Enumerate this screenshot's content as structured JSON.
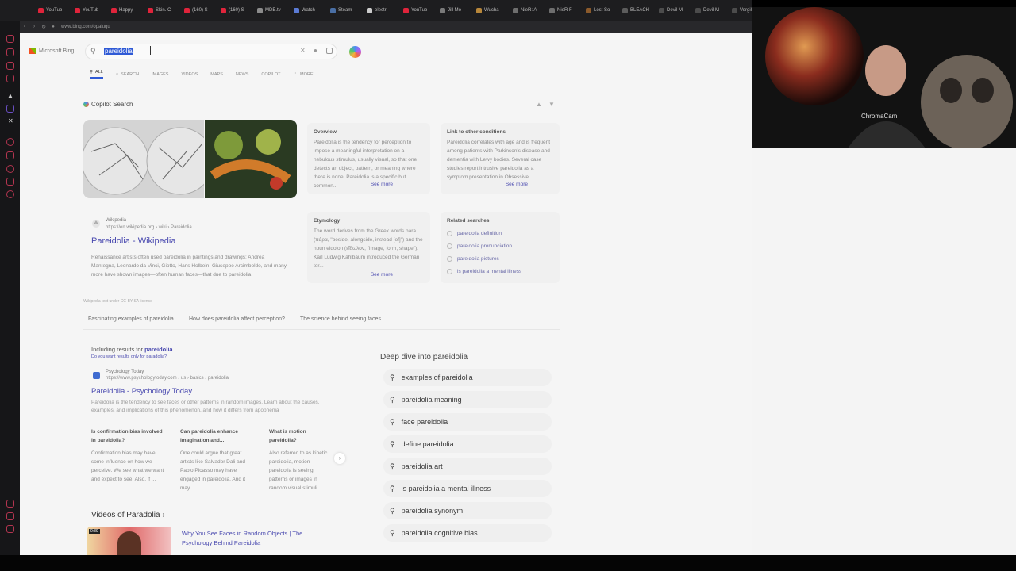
{
  "browser": {
    "tabs": [
      "YouTub",
      "YouTub",
      "Happy",
      "Skin. C",
      "(160) S",
      "(160) S",
      "MDE.tv",
      "Watch",
      "Steam",
      "electr",
      "YouTub",
      "Jill Mo",
      "Wucha",
      "NieR: A",
      "NieR F",
      "Lost So",
      "BLEACH",
      "Devil M",
      "Devil M",
      "Vergil"
    ],
    "tab_colors": [
      "#e0243b",
      "#e0243b",
      "#e0243b",
      "#e0243b",
      "#e0243b",
      "#e0243b",
      "#8c8c8c",
      "#5b7bd5",
      "#4a6fa5",
      "#cccccc",
      "#e0243b",
      "#7a7a7a",
      "#b8873a",
      "#6e6e6e",
      "#6e6e6e",
      "#8b5a2b",
      "#5c5c5c",
      "#4c4c4c",
      "#4c4c4c",
      "#4c4c4c"
    ],
    "url": "www.bing.com/opaluqu"
  },
  "search": {
    "brand": "Microsoft Bing",
    "query": "pareidolia",
    "scopes": [
      "ALL",
      "SEARCH",
      "IMAGES",
      "VIDEOS",
      "MAPS",
      "NEWS",
      "COPILOT",
      "MORE"
    ]
  },
  "copilot": {
    "title": "Copilot Search",
    "wiki_source": "Wikipedia",
    "wiki_url": "https://en.wikipedia.org › wiki › Pareidolia",
    "wiki_title": "Pareidolia - Wikipedia",
    "wiki_snippet": "Renaissance artists often used pareidolia in paintings and drawings: Andrea Mantegna, Leonardo da Vinci, Giotto, Hans Holbein, Giuseppe Arcimboldo, and many more have shown images—often human faces—that due to pareidolia",
    "wiki_license": "Wikipedia text under CC-BY-SA license",
    "overview_title": "Overview",
    "overview_text": "Pareidolia is the tendency for perception to impose a meaningful interpretation on a nebulous stimulus, usually visual, so that one detects an object, pattern, or meaning where there is none. Pareidolia is a specific but common...",
    "see_more": "See more",
    "link_title": "Link to other conditions",
    "link_text": "Pareidolia correlates with age and is frequent among patients with Parkinson's disease and dementia with Lewy bodies. Several case studies report intrusive pareidolia as a symptom presentation in Obsessive ...",
    "etym_title": "Etymology",
    "etym_text": "The word derives from the Greek words para (πάρα, \"beside, alongside, instead [of]\") and the noun eidolon (εἴδωλον, \"image, form, shape\"). Karl Ludwig Kahlbaum introduced the German ter...",
    "related_title": "Related searches",
    "related": [
      "pareidolia definition",
      "pareidolia pronunciation",
      "pareidolia pictures",
      "is pareidolia a mental illness"
    ],
    "chips": [
      "Fascinating examples of pareidolia",
      "How does pareidolia affect perception?",
      "The science behind seeing faces"
    ]
  },
  "results": {
    "including_prefix": "Including results for",
    "including_term": "pareidolia",
    "only_text": "Do you want results only for paradolia?",
    "pt_source": "Psychology Today",
    "pt_url": "https://www.psychologytoday.com › us › basics › pareidolia",
    "pt_title": "Pareidolia - Psychology Today",
    "pt_snippet": "Pareidolia is the tendency to see faces or other patterns in random images. Learn about the causes, examples, and implications of this phenomenon, and how it differs from apophenia",
    "paa": [
      {
        "q": "Is confirmation bias involved in pareidolia?",
        "a": "Confirmation bias may have some influence on how we perceive. We see what we want and expect to see. Also, if ..."
      },
      {
        "q": "Can pareidolia enhance imagination and...",
        "a": "One could argue that great artists like Salvador Dali and Pablo Picasso may have engaged in pareidolia. And it may..."
      },
      {
        "q": "What is motion pareidolia?",
        "a": "Also referred to as kinetic pareidolia, motion pareidolia is seeing patterns or images in random visual stimuli..."
      }
    ],
    "videos_title": "Videos of Paradolia",
    "video_duration": "0:39",
    "video_title": "Why You See Faces in Random Objects | The Psychology Behind Pareidolia"
  },
  "deep_dive": {
    "title": "Deep dive into pareidolia",
    "items": [
      "examples of pareidolia",
      "pareidolia meaning",
      "face pareidolia",
      "define pareidolia",
      "pareidolia art",
      "is pareidolia a mental illness",
      "pareidolia synonym",
      "pareidolia cognitive bias"
    ]
  },
  "webcam": {
    "label": "ChromaCam"
  }
}
